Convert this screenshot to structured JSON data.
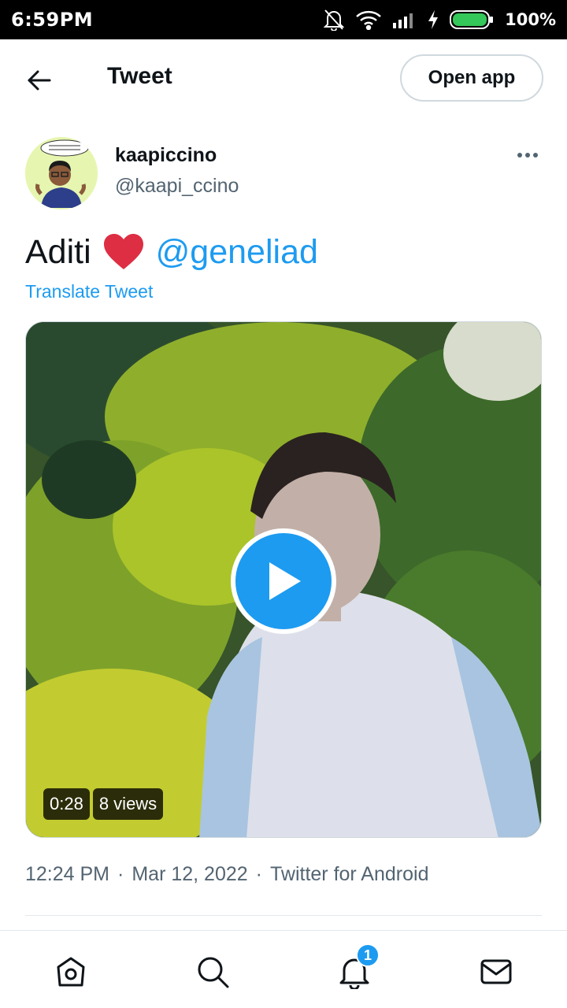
{
  "status_bar": {
    "time": "6:59PM",
    "battery": "100%",
    "icons": [
      "bell-off-icon",
      "wifi-icon",
      "signal-icon",
      "charging-icon",
      "battery-icon"
    ]
  },
  "header": {
    "title": "Tweet",
    "open_app_label": "Open app",
    "back_icon": "arrow-left-icon"
  },
  "tweet": {
    "author": {
      "display_name": "kaapiccino",
      "handle": "@kaapi_ccino"
    },
    "text": "Aditi",
    "emoji": "❤️",
    "mention": "@geneliad",
    "translate_label": "Translate Tweet",
    "media": {
      "duration": "0:28",
      "views": "8 views"
    },
    "time": "12:24 PM",
    "date": "Mar 12, 2022",
    "source": "Twitter for Android"
  },
  "bottom_nav": {
    "items": [
      "home-icon",
      "search-icon",
      "notifications-icon",
      "messages-icon"
    ],
    "notification_count": "1"
  },
  "colors": {
    "accent": "#1d9bf0",
    "text_primary": "#0f1419",
    "text_secondary": "#536471",
    "border": "#cfd9de"
  }
}
